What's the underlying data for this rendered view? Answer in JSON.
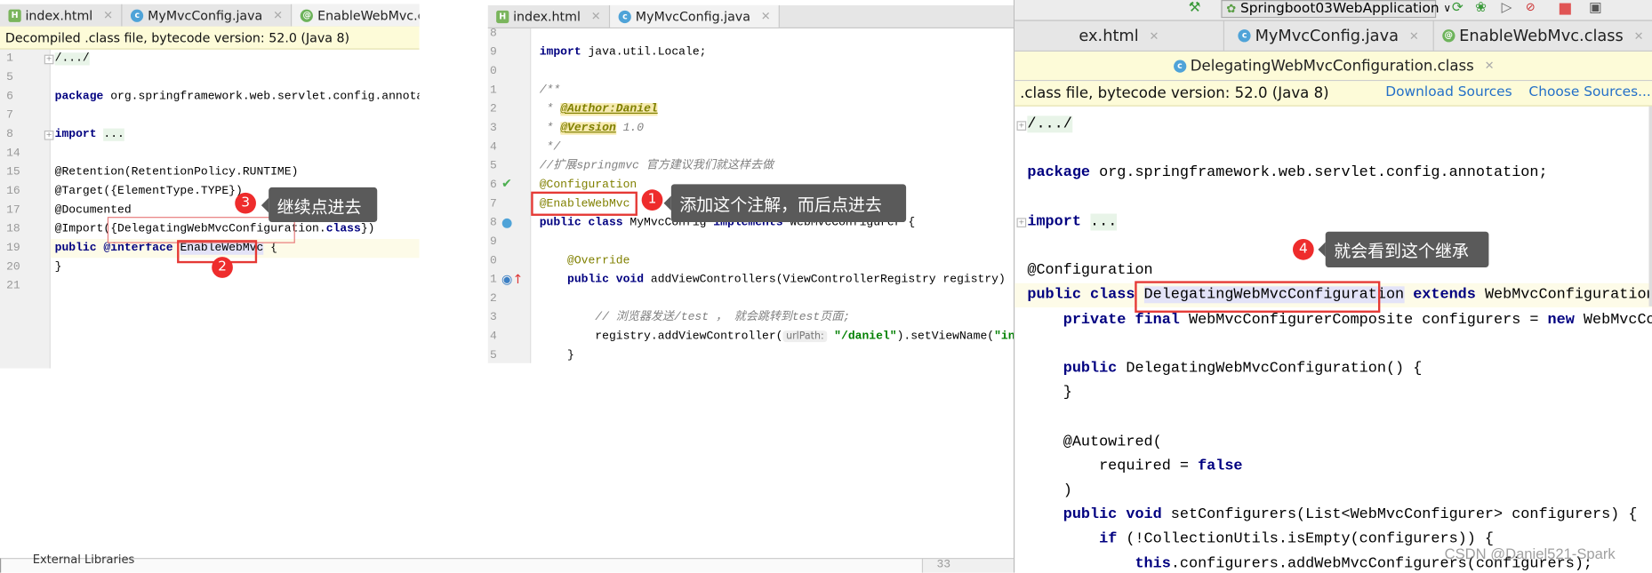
{
  "background_window": {
    "tree_item": "External Libraries",
    "line_number": "33"
  },
  "left_panel": {
    "tabs": [
      {
        "label": "index.html",
        "icon": "html-file-icon"
      },
      {
        "label": "MyMvcConfig.java",
        "icon": "java-class-icon"
      },
      {
        "label": "EnableWebMvc.class",
        "icon": "annotation-class-icon",
        "active": true
      }
    ],
    "banner": "Decompiled .class file, bytecode version: 52.0 (Java 8)",
    "line_numbers": [
      "1",
      "5",
      "6",
      "7",
      "8",
      "14",
      "15",
      "16",
      "17",
      "18",
      "19",
      "20",
      "21"
    ],
    "lines": [
      [
        {
          "t": "/.../",
          "c": "fold"
        }
      ],
      [],
      [
        {
          "t": "package",
          "c": "kw"
        },
        {
          "t": " org.springframework.web.servlet.config.annotation;"
        }
      ],
      [],
      [
        {
          "t": "import",
          "c": "kw"
        },
        {
          "t": " "
        },
        {
          "t": "...",
          "c": "fold"
        }
      ],
      [],
      [
        {
          "t": "@Retention(RetentionPolicy.RUNTIME)"
        }
      ],
      [
        {
          "t": "@Target({ElementType.TYPE})"
        }
      ],
      [
        {
          "t": "@Documented"
        }
      ],
      [
        {
          "t": "@Import({DelegatingWebMvcConfiguration."
        },
        {
          "t": "class",
          "c": "kw"
        },
        {
          "t": "})"
        }
      ],
      [
        {
          "t": "public",
          "c": "kw"
        },
        {
          "t": " "
        },
        {
          "t": "@interface",
          "c": "kw"
        },
        {
          "t": " "
        },
        {
          "t": "EnableWebMvc",
          "c": "sel"
        },
        {
          "t": " {"
        }
      ],
      [
        {
          "t": "}"
        }
      ],
      []
    ],
    "callouts": [
      {
        "number": "3",
        "text": "继续点进去"
      },
      {
        "number": "2",
        "text": ""
      }
    ]
  },
  "middle_panel": {
    "tabs": [
      {
        "label": "index.html",
        "icon": "html-file-icon"
      },
      {
        "label": "MyMvcConfig.java",
        "icon": "java-class-icon",
        "active": true
      }
    ],
    "line_numbers": [
      "8",
      "9",
      "0",
      "1",
      "2",
      "3",
      "4",
      "5",
      "6",
      "7",
      "8",
      "9",
      "0",
      "1",
      "2",
      "3",
      "4",
      "5"
    ],
    "lines": [
      [],
      [
        {
          "t": "import",
          "c": "kw"
        },
        {
          "t": " java.util.Locale;"
        }
      ],
      [],
      [
        {
          "t": "/**",
          "c": "cmt"
        }
      ],
      [
        {
          "t": " * ",
          "c": "cmt"
        },
        {
          "t": "@Author:Daniel",
          "c": "doc"
        }
      ],
      [
        {
          "t": " * ",
          "c": "cmt"
        },
        {
          "t": "@Version",
          "c": "doc"
        },
        {
          "t": " 1.0",
          "c": "cmt"
        }
      ],
      [
        {
          "t": " */",
          "c": "cmt"
        }
      ],
      [
        {
          "t": "//扩展springmvc 官方建议我们就这样去做",
          "c": "cmt"
        }
      ],
      [
        {
          "t": "@Configuration",
          "c": "ann"
        }
      ],
      [
        {
          "t": "@EnableWebMvc",
          "c": "ann"
        }
      ],
      [
        {
          "t": "public class",
          "c": "kw"
        },
        {
          "t": " MyMvcConfig "
        },
        {
          "t": "implements",
          "c": "kw"
        },
        {
          "t": " WebMvcConfigurer {"
        }
      ],
      [],
      [
        {
          "t": "    "
        },
        {
          "t": "@Override",
          "c": "ann"
        }
      ],
      [
        {
          "t": "    "
        },
        {
          "t": "public void",
          "c": "kw"
        },
        {
          "t": " addViewControllers(ViewControllerRegistry registry) {"
        }
      ],
      [],
      [
        {
          "t": "        "
        },
        {
          "t": "// 浏览器发送/test ， 就会跳转到test页面;",
          "c": "cmt"
        }
      ],
      [
        {
          "t": "        registry.addViewController("
        },
        {
          "t": "urlPath:",
          "c": "hint"
        },
        {
          "t": " "
        },
        {
          "t": "\"/daniel\"",
          "c": "str"
        },
        {
          "t": ").setViewName("
        },
        {
          "t": "\"index\"",
          "c": "str"
        },
        {
          "t": ")"
        }
      ],
      [
        {
          "t": "    }"
        }
      ]
    ],
    "callouts": [
      {
        "number": "1",
        "text": "添加这个注解，而后点进去"
      }
    ]
  },
  "right_panel": {
    "toolbar": {
      "run_config": "Springboot03WebApplication",
      "icons": [
        "build-hammer-icon",
        "rerun-icon",
        "debug-icon",
        "coverage-icon",
        "profiler-icon",
        "stop-icon",
        "project-structure-icon"
      ]
    },
    "tabs": [
      {
        "label": "ex.html",
        "icon": ""
      },
      {
        "label": "MyMvcConfig.java",
        "icon": "java-class-icon"
      },
      {
        "label": "EnableWebMvc.class",
        "icon": "annotation-class-icon"
      }
    ],
    "tabs_row2": [
      {
        "label": "DelegatingWebMvcConfiguration.class",
        "icon": "java-class-icon",
        "active": true
      }
    ],
    "banner": ".class file, bytecode version: 52.0 (Java 8)",
    "download_sources": "Download Sources",
    "choose_sources": "Choose Sources...",
    "lines": [
      [
        {
          "t": "/.../",
          "c": "fold"
        }
      ],
      [],
      [
        {
          "t": "package",
          "c": "kw"
        },
        {
          "t": " org.springframework.web.servlet.config.annotation;"
        }
      ],
      [],
      [
        {
          "t": "import",
          "c": "kw"
        },
        {
          "t": " "
        },
        {
          "t": "...",
          "c": "fold"
        }
      ],
      [],
      [
        {
          "t": "@Configuration"
        }
      ],
      [
        {
          "t": "public class",
          "c": "kw"
        },
        {
          "t": " "
        },
        {
          "t": "DelegatingWebMvcConfiguration",
          "c": "sel"
        },
        {
          "t": " "
        },
        {
          "t": "extends",
          "c": "kw"
        },
        {
          "t": " WebMvcConfigurationSupport {"
        }
      ],
      [
        {
          "t": "    "
        },
        {
          "t": "private final",
          "c": "kw"
        },
        {
          "t": " WebMvcConfigurerComposite configurers = "
        },
        {
          "t": "new",
          "c": "kw"
        },
        {
          "t": " WebMvcConfigurerComposite();"
        }
      ],
      [],
      [
        {
          "t": "    "
        },
        {
          "t": "public",
          "c": "kw"
        },
        {
          "t": " DelegatingWebMvcConfiguration() {"
        }
      ],
      [
        {
          "t": "    }"
        }
      ],
      [],
      [
        {
          "t": "    @Autowired("
        }
      ],
      [
        {
          "t": "        required = "
        },
        {
          "t": "false",
          "c": "kw"
        }
      ],
      [
        {
          "t": "    )"
        }
      ],
      [
        {
          "t": "    "
        },
        {
          "t": "public void",
          "c": "kw"
        },
        {
          "t": " setConfigurers(List<WebMvcConfigurer> configurers) {"
        }
      ],
      [
        {
          "t": "        "
        },
        {
          "t": "if",
          "c": "kw"
        },
        {
          "t": " (!CollectionUtils.isEmpty(configurers)) {"
        }
      ],
      [
        {
          "t": "            "
        },
        {
          "t": "this",
          "c": "kw"
        },
        {
          "t": ".configurers.addWebMvcConfigurers(configurers);"
        }
      ]
    ],
    "callouts": [
      {
        "number": "4",
        "text": "就会看到这个继承"
      }
    ]
  },
  "watermark": "CSDN @Daniel521-Spark",
  "colors": {
    "callout_badge": "#ee2c2c",
    "callout_bg": "#5a5a5a",
    "highlight_box": "#e53935",
    "keyword": "#000080",
    "link": "#2470c8"
  }
}
